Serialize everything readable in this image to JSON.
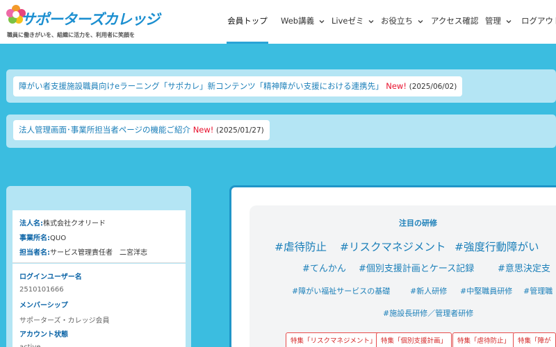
{
  "logo": {
    "title": "サポーターズカレッジ",
    "tagline": "職員に働きがいを、組織に活力を、利用者に笑顔を"
  },
  "nav": {
    "items": [
      {
        "label": "会員トップ",
        "active": true,
        "dropdown": false
      },
      {
        "label": "Web講義",
        "active": false,
        "dropdown": true
      },
      {
        "label": "Liveゼミ",
        "active": false,
        "dropdown": true
      },
      {
        "label": "お役立ち",
        "active": false,
        "dropdown": true
      },
      {
        "label": "アクセス確認",
        "active": false,
        "dropdown": false
      },
      {
        "label": "管理",
        "active": false,
        "dropdown": true
      },
      {
        "label": "ログアウト",
        "active": false,
        "dropdown": false
      }
    ]
  },
  "notices": [
    {
      "text": "障がい者支援施設職員向けeラーニング「サポカレ」新コンテンツ「精神障がい支援における連携先」",
      "badge": "New!",
      "date": "(2025/06/02)"
    },
    {
      "text": "法人管理画面･事業所担当者ページの機能ご紹介",
      "badge": "New!",
      "date": "(2025/01/27)"
    }
  ],
  "profile": {
    "corp_label": "法人名:",
    "corp_value": "株式会社クオリード",
    "office_label": "事業所名:",
    "office_value": "QUO",
    "manager_label": "担当者名:",
    "manager_value": "サービス管理責任者　二宮洋志"
  },
  "account": {
    "login_label": "ログインユーザー名",
    "login_value": "2510101666",
    "membership_label": "メンバーシップ",
    "membership_value": "サポーターズ・カレッジ会員",
    "status_label": "アカウント状態",
    "status_value": "active"
  },
  "featured": {
    "title": "注目の研修",
    "tags_row1": [
      "#虐待防止",
      "#リスクマネジメント",
      "#強度行動障がい"
    ],
    "tags_row2": [
      "#てんかん",
      "#個別支援計画とケース記録",
      "#意思決定支"
    ],
    "tags_row3": [
      "#障がい福祉サービスの基礎",
      "#新人研修",
      "#中堅職員研修",
      "#管理職"
    ],
    "tags_row4": [
      "#施設長研修／管理者研修"
    ],
    "buttons": [
      "特集「リスクマネジメント」",
      "特集「個別支援計画」",
      "特集「虐待防止」",
      "特集「障が"
    ]
  },
  "colors": {
    "page_bg": "#3bbde0",
    "accent": "#1b7fb9",
    "new_badge": "#e8112d",
    "panel_border": "#1f95c8"
  }
}
